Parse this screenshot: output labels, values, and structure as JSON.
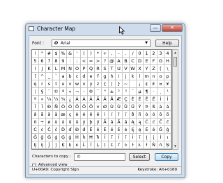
{
  "window": {
    "title": "Character Map",
    "minimize_label": "—",
    "close_label": "✕"
  },
  "font": {
    "label": "Font :",
    "icon_glyph": "O",
    "selected": "Arial",
    "help_label": "Help"
  },
  "grid": {
    "rows": [
      [
        "!",
        "\"",
        "#",
        "$",
        "%",
        "&",
        "'",
        "(",
        ")",
        "*",
        "+",
        ",",
        "-",
        ".",
        "/",
        "0",
        "1",
        "2",
        "3",
        "4"
      ],
      [
        "5",
        "6",
        "7",
        "8",
        "9",
        ":",
        ";",
        "<",
        "=",
        ">",
        "?",
        "@",
        "A",
        "B",
        "C",
        "D",
        "E",
        "F",
        "G",
        "H"
      ],
      [
        "I",
        "J",
        "K",
        "L",
        "M",
        "N",
        "O",
        "P",
        "Q",
        "R",
        "S",
        "T",
        "U",
        "V",
        "W",
        "X",
        "Y",
        "Z",
        "[",
        "\\"
      ],
      [
        "]",
        "^",
        "_",
        "`",
        "a",
        "b",
        "c",
        "d",
        "e",
        "f",
        "g",
        "h",
        "i",
        "j",
        "k",
        "l",
        "m",
        "n",
        "o",
        "p"
      ],
      [
        "q",
        "r",
        "s",
        "t",
        "u",
        "v",
        "w",
        "x",
        "y",
        "z",
        "{",
        "|",
        "}",
        "~",
        " ",
        "¡",
        "¢",
        "£",
        "¤",
        "¥"
      ],
      [
        "¦",
        "§",
        "¨",
        "©",
        "ª",
        "«",
        "¬",
        "-",
        "®",
        "¯",
        "°",
        "±",
        "²",
        "³",
        "´",
        "µ",
        "¶",
        "·",
        "¸",
        "¹"
      ],
      [
        "º",
        "»",
        "¼",
        "½",
        "¾",
        "¿",
        "À",
        "Á",
        "Â",
        "Ã",
        "Ä",
        "Å",
        "Æ",
        "Ç",
        "È",
        "É",
        "Ê",
        "Ë",
        "Ì",
        "Í"
      ],
      [
        "Î",
        "Ï",
        "Ð",
        "Ñ",
        "Ò",
        "Ó",
        "Ô",
        "Õ",
        "Ö",
        "×",
        "Ø",
        "Ù",
        "Ú",
        "Û",
        "Ü",
        "Ý",
        "Þ",
        "ß",
        "à",
        "á"
      ],
      [
        "â",
        "ã",
        "ä",
        "å",
        "æ",
        "ç",
        "è",
        "é",
        "ê",
        "ë",
        "ì",
        "í",
        "î",
        "ï",
        "ð",
        "ñ",
        "ò",
        "ó",
        "ô",
        "õ"
      ],
      [
        "ö",
        "÷",
        "ø",
        "ù",
        "ú",
        "û",
        "ü",
        "ý",
        "þ",
        "ÿ",
        "Ā",
        "ā",
        "Ă",
        "ă",
        "Ą",
        "ą",
        "Ć",
        "ć",
        "Ĉ",
        "ĉ"
      ],
      [
        "Ċ",
        "ċ",
        "Č",
        "č",
        "Ď",
        "ď",
        "Đ",
        "đ",
        "Ē",
        "ē",
        "Ĕ",
        "ĕ",
        "Ė",
        "ė",
        "Ę",
        "ę",
        "Ě",
        "ě",
        "Ĝ",
        "ĝ"
      ],
      [
        "Ğ",
        "ğ",
        "Ġ",
        "ġ",
        "Ģ",
        "ģ",
        "Ĥ",
        "ĥ",
        "Ħ",
        "ħ",
        "Ĩ",
        "ĩ",
        "Ī",
        "ī",
        "Ĭ",
        "ĭ",
        "Į",
        "į",
        "İ",
        "ı"
      ],
      [
        "Ĳ",
        "ĳ",
        "Ĵ",
        "ĵ",
        "Ķ",
        "ķ",
        "ĸ",
        "Ĺ",
        "ĺ",
        "Ļ",
        "ļ",
        "Ľ",
        "ľ",
        "Ŀ",
        "ŀ",
        "Ł",
        "ł",
        "Ń",
        "ń",
        "Ņ"
      ]
    ],
    "selected_char": "©"
  },
  "copy": {
    "label": "Characters to copy :",
    "value": "©",
    "select_label": "Select",
    "copy_label": "Copy"
  },
  "advanced": {
    "label": "Advanced view",
    "checked": false
  },
  "status": {
    "left": "U+00A9: Copyright Sign",
    "right": "Keystroke: Alt+0169"
  }
}
